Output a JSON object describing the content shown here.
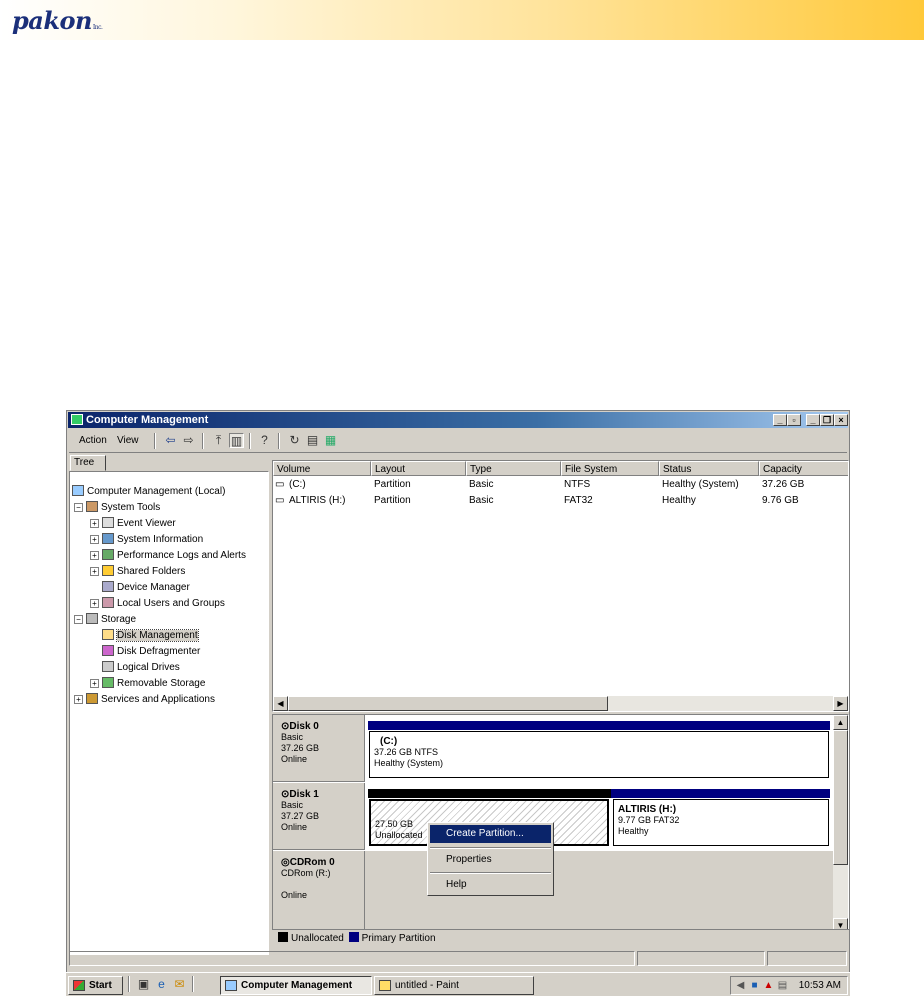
{
  "banner": {
    "logo_text": "pakon",
    "logo_suffix": "Inc."
  },
  "window": {
    "title": "Computer Management",
    "menu": [
      "Action",
      "View"
    ]
  },
  "tree": {
    "tab_label": "Tree",
    "items": [
      {
        "label": "Computer Management (Local)",
        "icon": "computer-icon"
      },
      {
        "label": "System Tools",
        "icon": "tools-icon"
      },
      {
        "label": "Event Viewer",
        "icon": "event-viewer-icon"
      },
      {
        "label": "System Information",
        "icon": "system-info-icon"
      },
      {
        "label": "Performance Logs and Alerts",
        "icon": "performance-icon"
      },
      {
        "label": "Shared Folders",
        "icon": "folder-icon"
      },
      {
        "label": "Device Manager",
        "icon": "device-manager-icon"
      },
      {
        "label": "Local Users and Groups",
        "icon": "users-icon"
      },
      {
        "label": "Storage",
        "icon": "storage-icon"
      },
      {
        "label": "Disk Management",
        "icon": "disk-management-icon"
      },
      {
        "label": "Disk Defragmenter",
        "icon": "defrag-icon"
      },
      {
        "label": "Logical Drives",
        "icon": "drive-icon"
      },
      {
        "label": "Removable Storage",
        "icon": "removable-storage-icon"
      },
      {
        "label": "Services and Applications",
        "icon": "services-icon"
      }
    ]
  },
  "volumes": {
    "columns": [
      "Volume",
      "Layout",
      "Type",
      "File System",
      "Status",
      "Capacity"
    ],
    "rows": [
      [
        "(C:)",
        "Partition",
        "Basic",
        "NTFS",
        "Healthy (System)",
        "37.26 GB"
      ],
      [
        "ALTIRIS (H:)",
        "Partition",
        "Basic",
        "FAT32",
        "Healthy",
        "9.76 GB"
      ]
    ]
  },
  "disks": [
    {
      "name": "Disk 0",
      "type": "Basic",
      "size": "37.26 GB",
      "state": "Online",
      "partition": {
        "label": "(C:)",
        "info": "37.26 GB NTFS",
        "status": "Healthy (System)"
      }
    },
    {
      "name": "Disk 1",
      "type": "Basic",
      "size": "37.27 GB",
      "state": "Online",
      "unallocated": {
        "size": "27.50 GB",
        "label": "Unallocated"
      },
      "partition": {
        "label": "ALTIRIS  (H:)",
        "info": "9.77 GB FAT32",
        "status": "Healthy"
      }
    },
    {
      "name": "CDRom 0",
      "type": "CDRom (R:)",
      "state": "Online"
    }
  ],
  "legend": {
    "unallocated": "Unallocated",
    "primary": "Primary Partition"
  },
  "colors": {
    "primary": "#000080",
    "unallocated": "#000000",
    "selection": "#0a246a"
  },
  "context_menu": {
    "items": [
      "Create Partition...",
      "Properties",
      "Help"
    ]
  },
  "taskbar": {
    "start": "Start",
    "buttons": [
      "Computer Management",
      "untitled - Paint"
    ],
    "clock": "10:53 AM"
  }
}
